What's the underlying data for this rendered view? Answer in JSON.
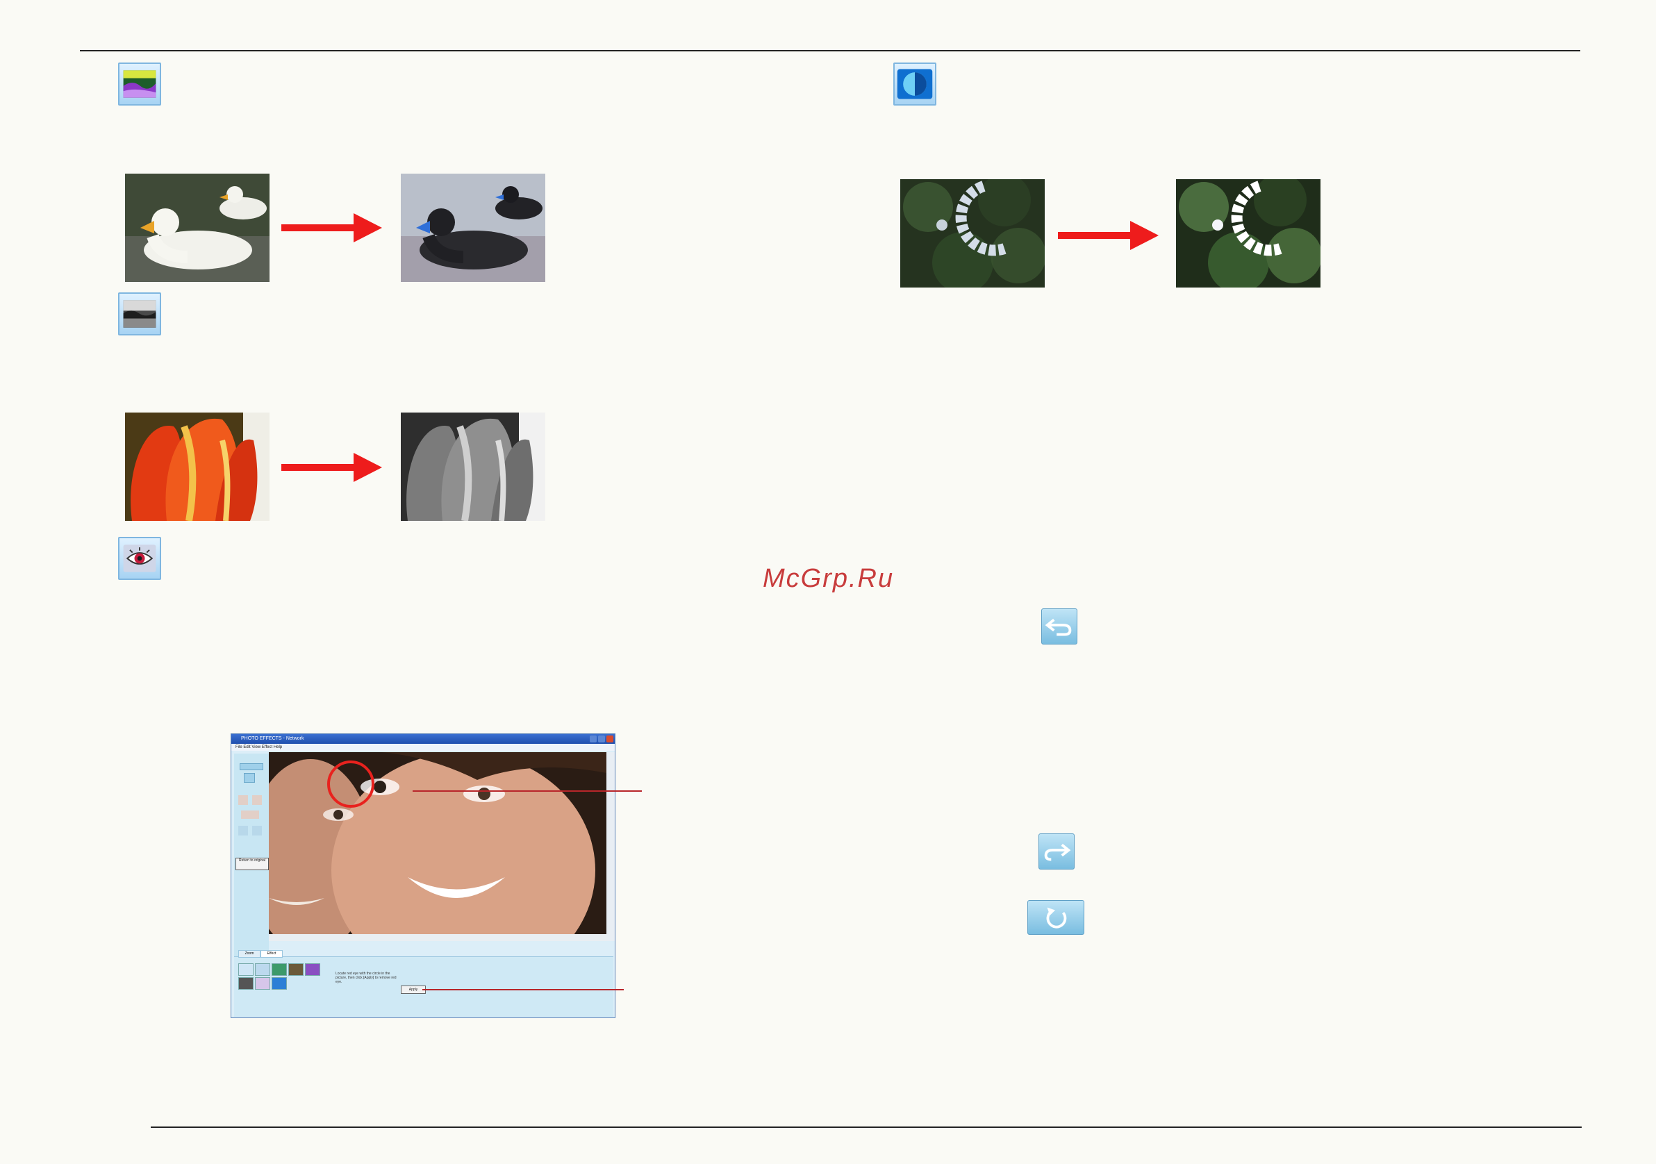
{
  "watermark": "McGrp.Ru",
  "colors": {
    "arrow": "#ee1c1c",
    "rule": "#222222",
    "callout": "#b8262a",
    "icon_frame": "#7fb6e0"
  },
  "tools": [
    {
      "icon": "negative-effect-icon"
    },
    {
      "icon": "monochrome-effect-icon"
    },
    {
      "icon": "red-eye-fix-icon"
    },
    {
      "icon": "sharpen-effect-icon"
    }
  ],
  "buttons": [
    {
      "icon": "undo-icon"
    },
    {
      "icon": "redo-icon"
    },
    {
      "icon": "return-to-original-icon"
    }
  ],
  "screenshot": {
    "title": "PHOTO EFFECTS - Network",
    "menu": "File  Edit  View  Effect  Help",
    "side_button": "Return to original",
    "tabs": [
      "Zoom",
      "Effect"
    ],
    "instruction": "Locate red eye with the circle in the picture, then click [Apply] to remove red eye.",
    "apply_label": "Apply"
  }
}
